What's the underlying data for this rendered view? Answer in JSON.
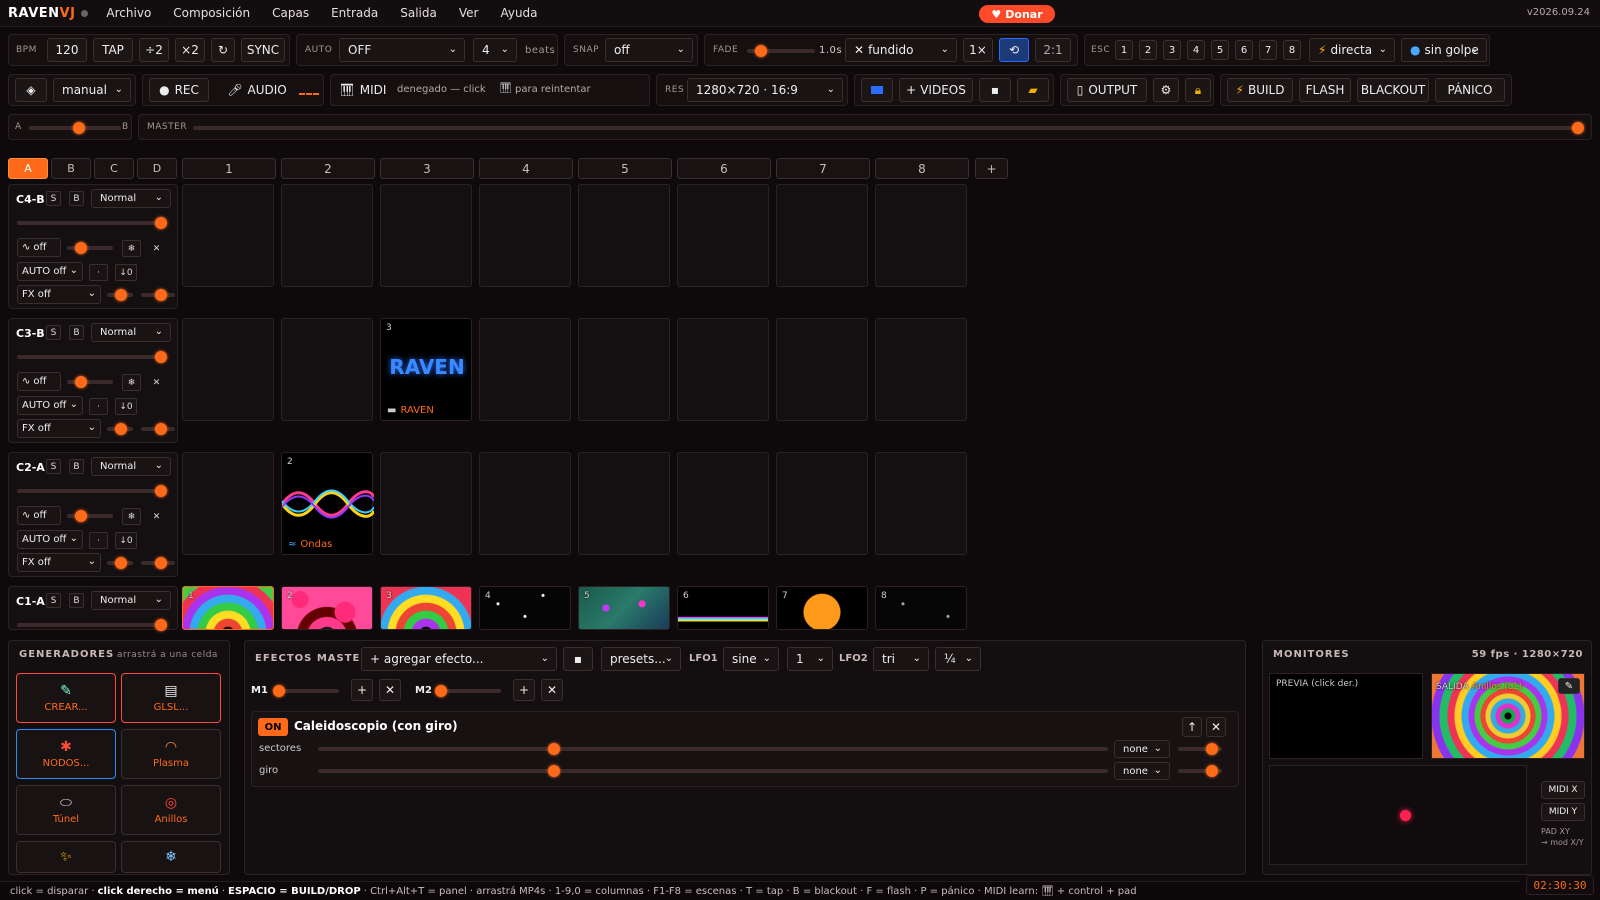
{
  "app": {
    "logo_main": "RAVEN",
    "logo_accent": "VJ",
    "version": "v2026.09.24",
    "donate": "Donar"
  },
  "menu": [
    "Archivo",
    "Composición",
    "Capas",
    "Entrada",
    "Salida",
    "Ver",
    "Ayuda"
  ],
  "toolbar1": {
    "bpm_label": "BPM",
    "bpm_value": "120",
    "tap": "TAP",
    "div2": "÷2",
    "mul2": "×2",
    "sync": "SYNC",
    "auto_label": "AUTO",
    "auto_value": "OFF",
    "beats_value": "4",
    "beats_label": "beats",
    "snap_label": "SNAP",
    "snap_value": "off",
    "fade_label": "FADE",
    "fade_time": "1.0s",
    "fade_mode": "fundido",
    "speed": "1×",
    "ratio": "2:1",
    "esc_label": "ESC",
    "scenes": [
      "1",
      "2",
      "3",
      "4",
      "5",
      "6",
      "7",
      "8"
    ],
    "direct": "directa",
    "nohit": "sin golpe"
  },
  "toolbar2": {
    "mode": "manual",
    "rec": "REC",
    "audio": "AUDIO",
    "midi": "MIDI",
    "midi_status": "denegado — click",
    "midi_retry": "para reintentar",
    "res_label": "RES",
    "res_value": "1280×720 · 16:9",
    "videos": "VIDEOS",
    "output": "OUTPUT",
    "build": "BUILD",
    "flash": "FLASH",
    "blackout": "BLACKOUT",
    "panic": "PÁNICO"
  },
  "crossfader": {
    "a": "A",
    "b": "B",
    "position": 0.55,
    "master_label": "MASTER",
    "master_level": 1.0
  },
  "decks": [
    "A",
    "B",
    "C",
    "D"
  ],
  "columns": [
    "1",
    "2",
    "3",
    "4",
    "5",
    "6",
    "7",
    "8",
    "+"
  ],
  "layers": [
    {
      "name": "C4-B",
      "blend": "Normal",
      "s": "S",
      "b": "B",
      "lfo": "off",
      "auto": "AUTO off",
      "fx": "FX off",
      "beat": "↓0"
    },
    {
      "name": "C3-B",
      "blend": "Normal",
      "s": "S",
      "b": "B",
      "lfo": "off",
      "auto": "AUTO off",
      "fx": "FX off",
      "beat": "↓0"
    },
    {
      "name": "C2-A",
      "blend": "Normal",
      "s": "S",
      "b": "B",
      "lfo": "off",
      "auto": "AUTO off",
      "fx": "FX off",
      "beat": "↓0"
    },
    {
      "name": "C1-A",
      "blend": "Normal",
      "s": "S",
      "b": "B"
    }
  ],
  "clips": {
    "raven": {
      "num": "3",
      "text": "RAVEN",
      "name": "RAVEN"
    },
    "ondas": {
      "num": "2",
      "name": "Ondas"
    },
    "row1": [
      "1",
      "2",
      "3",
      "4",
      "5",
      "6",
      "7",
      "8"
    ]
  },
  "generators": {
    "title": "GENERADORES",
    "hint": "arrastrá a una celda",
    "items": [
      "CREAR...",
      "GLSL...",
      "NODOS...",
      "Plasma",
      "Túnel",
      "Anillos"
    ]
  },
  "effects": {
    "title": "EFECTOS MASTER",
    "add": "+ agregar efecto...",
    "presets": "presets...",
    "lfo1_label": "LFO1",
    "lfo1_shape": "sine",
    "lfo1_rate": "1",
    "lfo2_label": "LFO2",
    "lfo2_shape": "tri",
    "lfo2_rate": "¼",
    "m1": "M1",
    "m2": "M2",
    "on": "ON",
    "effect_name": "Caleidoscopio (con giro)",
    "params": [
      {
        "name": "sectores",
        "mod": "none",
        "value": 0.3
      },
      {
        "name": "giro",
        "mod": "none",
        "value": 0.3
      }
    ]
  },
  "monitors": {
    "title": "MONITORES",
    "stats": "59 fps · 1280×720",
    "preview": "PREVIA (click der.)",
    "output_label": "SALIDA ·",
    "output_clip": "Anillos (c1)",
    "midi_x": "MIDI X",
    "midi_y": "MIDI Y",
    "pad_xy": "PAD XY",
    "mod_xy": "→ mod X/Y",
    "timer": "02:30:30"
  },
  "status": {
    "p1": "click = disparar · ",
    "p2": "click derecho = menú",
    "p3": " · ",
    "p4": "ESPACIO = BUILD/DROP",
    "p5": " · Ctrl+Alt+T = panel · arrastrá MP4s · 1-9,0 = columnas · F1-F8 = escenas · T = tap · B = blackout · F = flash · P = pánico · MIDI learn: ",
    "p6": " + control + pad"
  },
  "colors": {
    "accent": "#ff6a1a",
    "danger": "#ff4a2a",
    "blue": "#2a6cff"
  }
}
